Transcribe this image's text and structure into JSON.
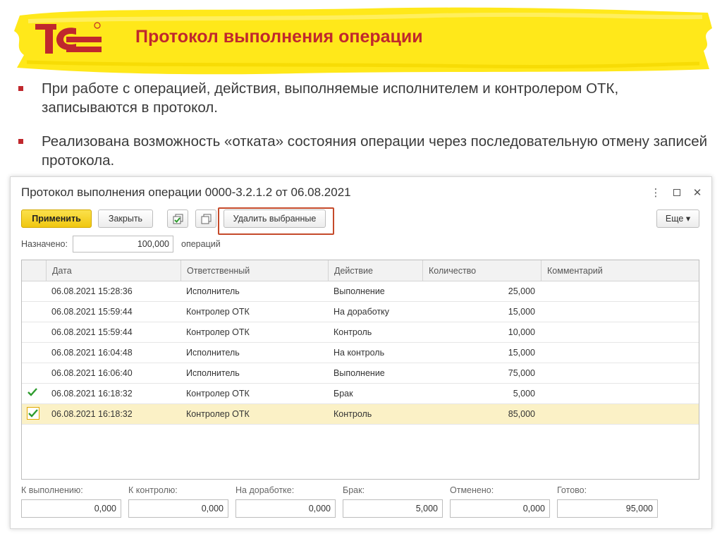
{
  "slide": {
    "title": "Протокол выполнения операции",
    "logo_text": "1С",
    "bullets": [
      "При работе с операцией, действия, выполняемые исполнителем и контролером ОТК, записываются в протокол.",
      "Реализована возможность «отката» состояния операции через последовательную отмену записей протокола."
    ]
  },
  "window": {
    "title": "Протокол выполнения операции 0000-3.2.1.2 от 06.08.2021",
    "controls": {
      "more": "⋮",
      "close": "✕"
    },
    "toolbar": {
      "apply_label": "Применить",
      "close_label": "Закрыть",
      "delete_selected_label": "Удалить выбранные",
      "more_label": "Еще ▾"
    },
    "assigned": {
      "label": "Назначено:",
      "value": "100,000",
      "unit": "операций"
    },
    "table": {
      "columns": [
        "Дата",
        "Ответственный",
        "Действие",
        "Количество",
        "Комментарий"
      ],
      "rows": [
        {
          "checked": false,
          "date": "06.08.2021 15:28:36",
          "responsible": "Исполнитель",
          "action": "Выполнение",
          "qty": "25,000",
          "comment": ""
        },
        {
          "checked": false,
          "date": "06.08.2021 15:59:44",
          "responsible": "Контролер ОТК",
          "action": "На доработку",
          "qty": "15,000",
          "comment": ""
        },
        {
          "checked": false,
          "date": "06.08.2021 15:59:44",
          "responsible": "Контролер ОТК",
          "action": "Контроль",
          "qty": "10,000",
          "comment": ""
        },
        {
          "checked": false,
          "date": "06.08.2021 16:04:48",
          "responsible": "Исполнитель",
          "action": "На контроль",
          "qty": "15,000",
          "comment": ""
        },
        {
          "checked": false,
          "date": "06.08.2021 16:06:40",
          "responsible": "Исполнитель",
          "action": "Выполнение",
          "qty": "75,000",
          "comment": ""
        },
        {
          "checked": true,
          "date": "06.08.2021 16:18:32",
          "responsible": "Контролер ОТК",
          "action": "Брак",
          "qty": "5,000",
          "comment": ""
        },
        {
          "checked": true,
          "date": "06.08.2021 16:18:32",
          "responsible": "Контролер ОТК",
          "action": "Контроль",
          "qty": "85,000",
          "comment": "",
          "selected": true
        }
      ]
    },
    "totals": [
      {
        "label": "К выполнению:",
        "value": "0,000"
      },
      {
        "label": "К контролю:",
        "value": "0,000"
      },
      {
        "label": "На доработке:",
        "value": "0,000"
      },
      {
        "label": "Брак:",
        "value": "5,000"
      },
      {
        "label": "Отменено:",
        "value": "0,000"
      },
      {
        "label": "Готово:",
        "value": "95,000"
      }
    ]
  },
  "colors": {
    "brand_red": "#c0282d",
    "banner_yellow": "#ffe81a",
    "primary_button": "#f5d320",
    "selected_row": "#fbf1c6",
    "highlight_border": "#c54a2a"
  }
}
